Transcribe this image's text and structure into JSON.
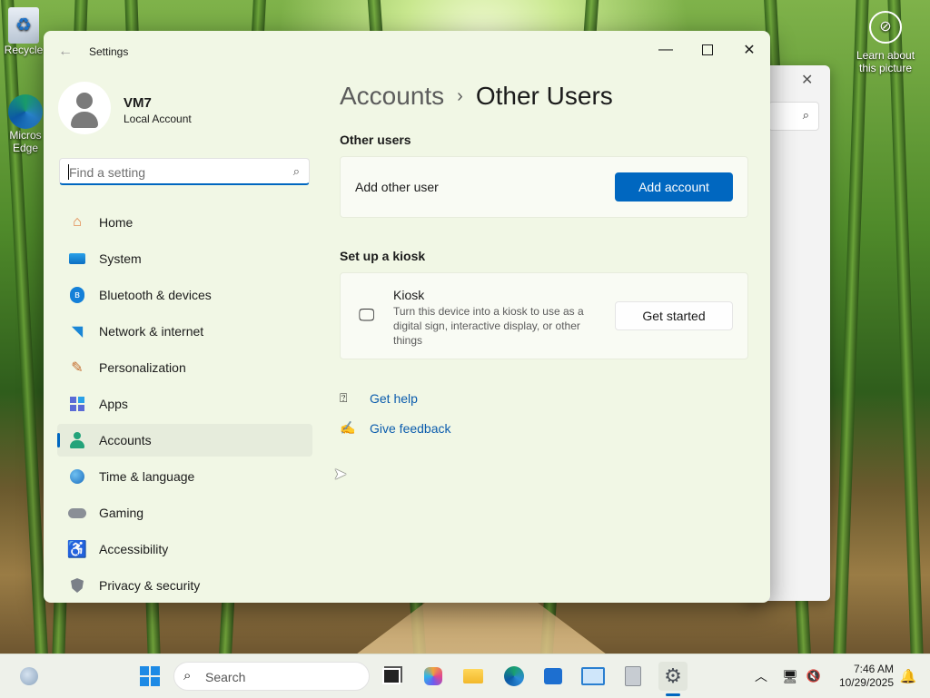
{
  "desktop": {
    "recycle_label": "Recycle",
    "edge_label_1": "Micros",
    "edge_label_2": "Edge",
    "learn_line1": "Learn about",
    "learn_line2": "this picture"
  },
  "window": {
    "title": "Settings",
    "profile": {
      "name": "VM7",
      "account_type": "Local Account"
    },
    "search_placeholder": "Find a setting",
    "nav": [
      {
        "label": "Home",
        "icon": "home-icon"
      },
      {
        "label": "System",
        "icon": "system-icon"
      },
      {
        "label": "Bluetooth & devices",
        "icon": "bluetooth-icon"
      },
      {
        "label": "Network & internet",
        "icon": "wifi-icon"
      },
      {
        "label": "Personalization",
        "icon": "brush-icon"
      },
      {
        "label": "Apps",
        "icon": "apps-icon"
      },
      {
        "label": "Accounts",
        "icon": "accounts-icon",
        "selected": true
      },
      {
        "label": "Time & language",
        "icon": "globe-clock-icon"
      },
      {
        "label": "Gaming",
        "icon": "gamepad-icon"
      },
      {
        "label": "Accessibility",
        "icon": "accessibility-icon"
      },
      {
        "label": "Privacy & security",
        "icon": "shield-icon"
      }
    ]
  },
  "page": {
    "breadcrumb_parent": "Accounts",
    "breadcrumb_current": "Other Users",
    "other_users_heading": "Other users",
    "add_other_user_label": "Add other user",
    "add_account_button": "Add account",
    "kiosk_heading": "Set up a kiosk",
    "kiosk_title": "Kiosk",
    "kiosk_desc": "Turn this device into a kiosk to use as a digital sign, interactive display, or other things",
    "get_started_button": "Get started",
    "get_help": "Get help",
    "give_feedback": "Give feedback"
  },
  "taskbar": {
    "search_text": "Search",
    "time": "7:46 AM",
    "date": "10/29/2025"
  },
  "colors": {
    "accent": "#0067c0",
    "link": "#0b5cad"
  }
}
